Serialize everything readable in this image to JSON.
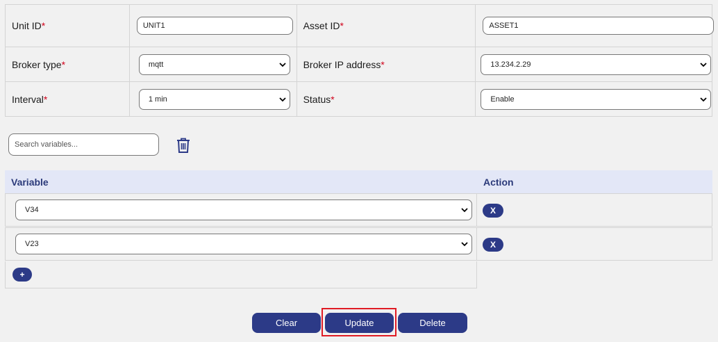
{
  "form": {
    "unit_id_label": "Unit ID",
    "unit_id_value": "UNIT1",
    "asset_id_label": "Asset ID",
    "asset_id_value": "ASSET1",
    "broker_type_label": "Broker type",
    "broker_type_value": "mqtt",
    "broker_ip_label": "Broker IP address",
    "broker_ip_value": "13.234.2.29",
    "interval_label": "Interval",
    "interval_value": "1 min",
    "status_label": "Status",
    "status_value": "Enable",
    "required_mark": "*"
  },
  "search": {
    "placeholder": "Search variables..."
  },
  "variables": {
    "col_variable": "Variable",
    "col_action": "Action",
    "rows": [
      {
        "value": "V34",
        "action_label": "X"
      },
      {
        "value": "V23",
        "action_label": "X"
      }
    ],
    "add_label": "+"
  },
  "actions": {
    "clear_label": "Clear",
    "update_label": "Update",
    "delete_label": "Delete"
  },
  "colors": {
    "primary": "#2c3a87",
    "header_bg": "#e3e7f7",
    "required": "#d0021b",
    "highlight": "#e01b24"
  }
}
